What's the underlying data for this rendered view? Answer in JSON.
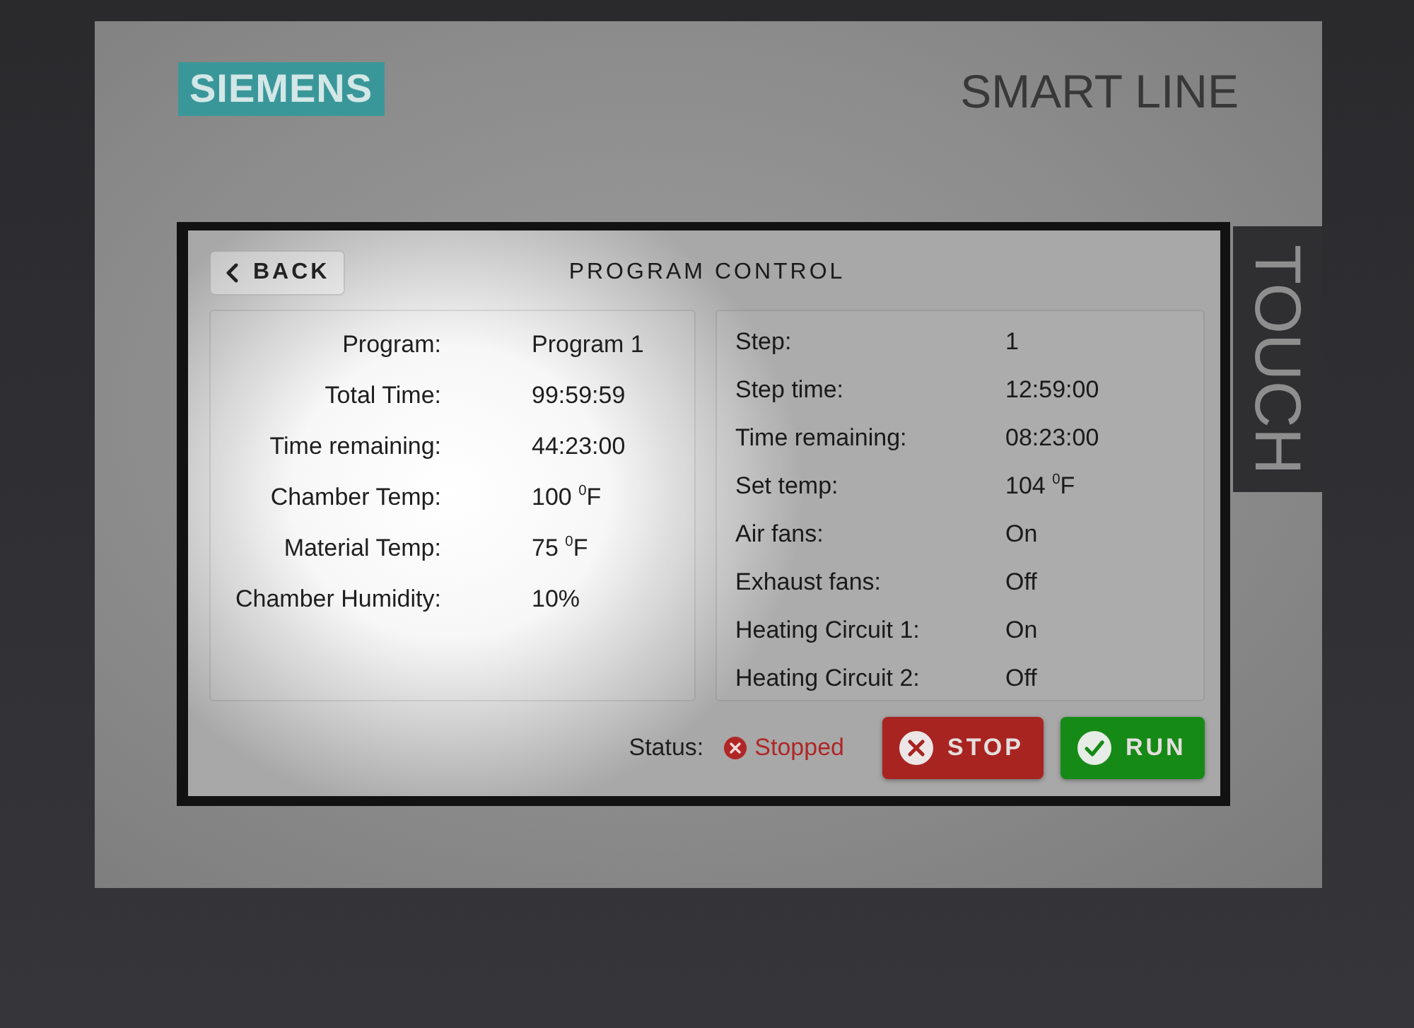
{
  "device": {
    "brand": "SIEMENS",
    "series": "SMART LINE",
    "side_label": "TOUCH"
  },
  "screen": {
    "back_button": {
      "label": "BACK"
    },
    "title": "PROGRAM CONTROL",
    "program_info": [
      {
        "label": "Program:",
        "value": "Program 1"
      },
      {
        "label": "Total Time:",
        "value": "99:59:59"
      },
      {
        "label": "Time remaining:",
        "value": "44:23:00"
      },
      {
        "label": "Chamber Temp:",
        "value": "100 $^{0}$F"
      },
      {
        "label": "Material Temp:",
        "value": "75 $^{0}$F"
      },
      {
        "label": "Chamber Humidity:",
        "value": "10%"
      }
    ],
    "step_info": [
      {
        "label": "Step:",
        "value": "1"
      },
      {
        "label": "Step time:",
        "value": "12:59:00"
      },
      {
        "label": "Time remaining:",
        "value": "08:23:00"
      },
      {
        "label": "Set temp:",
        "value": "104 $^{0}$F"
      },
      {
        "label": "Air fans:",
        "value": "On"
      },
      {
        "label": "Exhaust fans:",
        "value": "Off"
      },
      {
        "label": "Heating Circuit 1:",
        "value": "On"
      },
      {
        "label": "Heating Circuit 2:",
        "value": "Off"
      }
    ],
    "status": {
      "label": "Status:",
      "value": "Stopped",
      "kind": "stopped"
    },
    "buttons": [
      {
        "kind": "stop",
        "label": "STOP"
      },
      {
        "kind": "run",
        "label": "RUN"
      }
    ]
  }
}
